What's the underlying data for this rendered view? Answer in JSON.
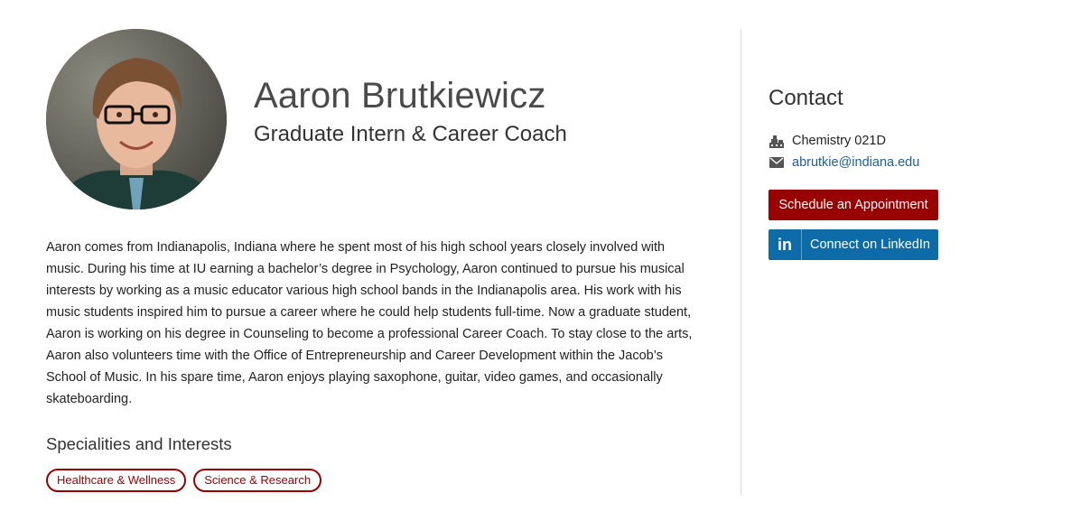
{
  "profile": {
    "name": "Aaron Brutkiewicz",
    "title": "Graduate Intern & Career Coach",
    "bio": "Aaron comes from Indianapolis, Indiana where he spent most of his high school years closely involved with music. During his time at IU earning a bachelor’s degree in Psychology, Aaron continued to pursue his musical interests by working as a music educator various high school bands in the Indianapolis area. His work with his music students inspired him to pursue a career where he could help students full-time. Now a graduate student, Aaron is working on his degree in Counseling to become a professional Career Coach. To stay close to the arts, Aaron also volunteers time with the Office of Entrepreneurship and Career Development within the Jacob’s School of Music. In his spare time, Aaron enjoys playing saxophone, guitar, video games, and occasionally skateboarding."
  },
  "interests": {
    "heading": "Specialities and Interests",
    "tags": [
      "Healthcare & Wellness",
      "Science & Research"
    ]
  },
  "contact": {
    "heading": "Contact",
    "location": "Chemistry 021D",
    "email": "abrutkie@indiana.edu",
    "location_icon": "building-icon",
    "email_icon": "envelope-icon"
  },
  "actions": {
    "appointment_label": "Schedule an Appointment",
    "linkedin_label": "Connect on LinkedIn",
    "linkedin_icon_text": "in"
  },
  "colors": {
    "accent_crimson": "#990000",
    "linkedin_blue": "#0d6ca8",
    "link_blue": "#1f5da8"
  }
}
